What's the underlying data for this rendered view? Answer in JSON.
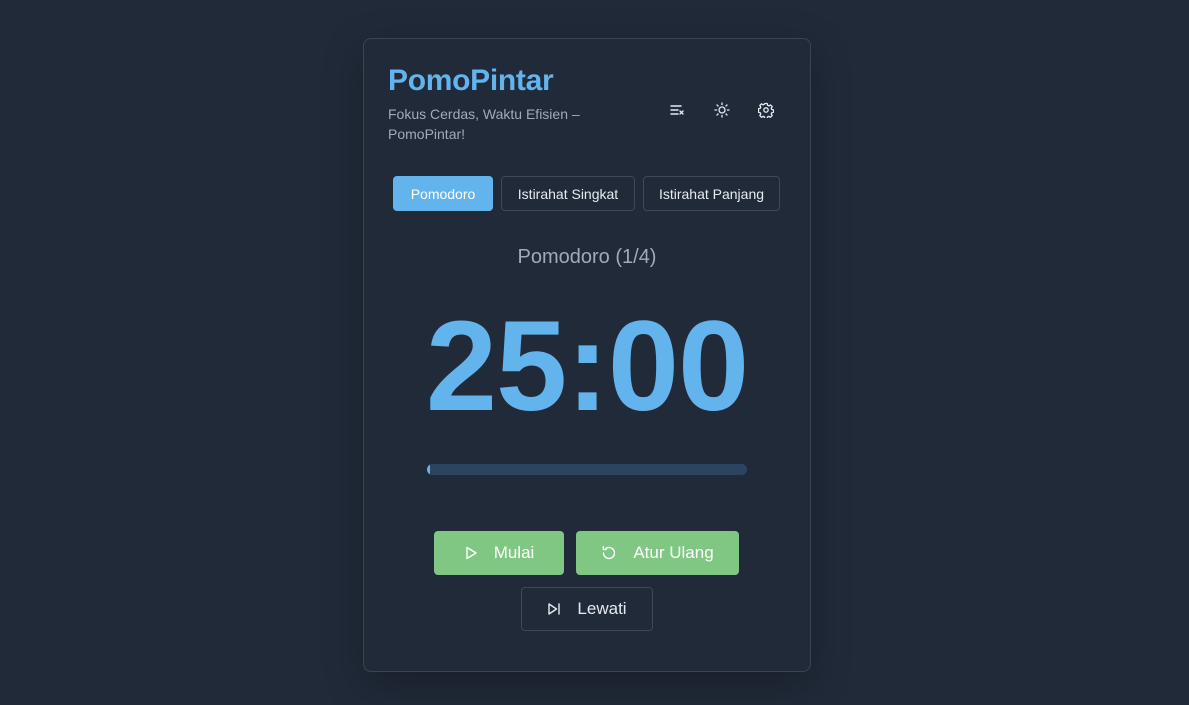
{
  "app": {
    "title": "PomoPintar",
    "subtitle": "Fokus Cerdas, Waktu Efisien – PomoPintar!"
  },
  "toolbar": {
    "icons": [
      "clear-list-icon",
      "sun-icon",
      "gear-icon"
    ]
  },
  "tabs": [
    {
      "label": "Pomodoro",
      "active": true
    },
    {
      "label": "Istirahat Singkat",
      "active": false
    },
    {
      "label": "Istirahat Panjang",
      "active": false
    }
  ],
  "timer": {
    "mode_label": "Pomodoro (1/4)",
    "display": "25:00",
    "progress_fraction": 0.01
  },
  "controls": {
    "start_label": "Mulai",
    "reset_label": "Atur Ulang",
    "skip_label": "Lewati"
  },
  "colors": {
    "background": "#212a39",
    "accent": "#63b3ed",
    "button_green": "#81c784",
    "progress_track": "#2c4460"
  }
}
